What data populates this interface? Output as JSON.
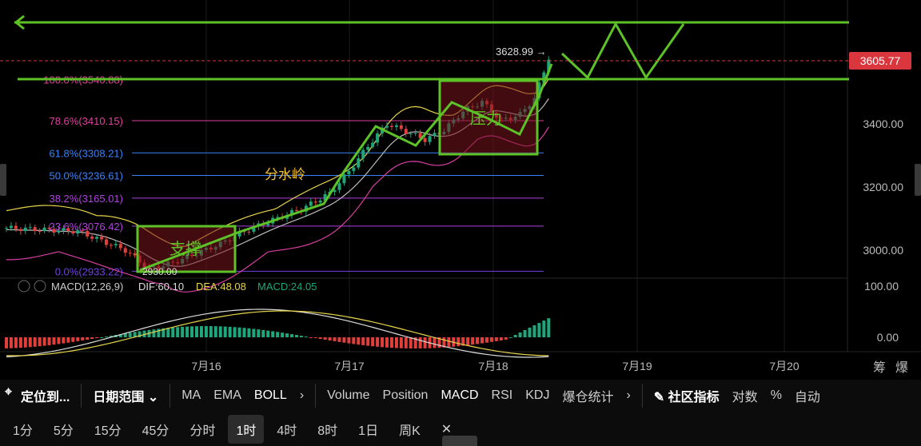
{
  "chart_data": {
    "type": "candlestick",
    "price_axis": {
      "ticks": [
        "3400.00",
        "3200.00",
        "3000.00"
      ],
      "current_price": "3605.77",
      "max_label": "3628.99",
      "min_label": "2930.00"
    },
    "macd_axis": {
      "ticks": [
        "100.00",
        "0.00"
      ]
    },
    "x_axis": {
      "ticks": [
        "7月16",
        "7月17",
        "7月18",
        "7月19",
        "7月20"
      ]
    },
    "fib_levels": [
      {
        "label": "100.0%(3540.88)",
        "price": 3540.88,
        "color": "#e040a0"
      },
      {
        "label": "78.6%(3410.15)",
        "price": 3410.15,
        "color": "#e040a0"
      },
      {
        "label": "61.8%(3308.21)",
        "price": 3308.21,
        "color": "#3b82f6"
      },
      {
        "label": "50.0%(3236.61)",
        "price": 3236.61,
        "color": "#3b82f6"
      },
      {
        "label": "38.2%(3165.01)",
        "price": 3165.01,
        "color": "#b040e0"
      },
      {
        "label": "23.6%(3076.42)",
        "price": 3076.42,
        "color": "#b040e0"
      },
      {
        "label": "0.0%(2933.22)",
        "price": 2933.22,
        "color": "#7040e0"
      }
    ],
    "annotations": {
      "support": "支撑",
      "resistance": "压力",
      "watershed": "分水岭"
    },
    "macd": {
      "title": "MACD(12,26,9)",
      "dif": "DIF:60.10",
      "dea": "DEA:48.08",
      "macd": "MACD:24.05"
    },
    "right_icons": [
      "筹",
      "爆"
    ]
  },
  "toolbar": {
    "locate": "定位到...",
    "date_range": "日期范围",
    "indicators": [
      "MA",
      "EMA",
      "BOLL"
    ],
    "sub_indicators": [
      "Volume",
      "Position",
      "MACD",
      "RSI",
      "KDJ",
      "爆仓统计"
    ],
    "community": "社区指标",
    "log": "对数",
    "pct": "%",
    "auto": "自动"
  },
  "intervals": [
    "1分",
    "5分",
    "15分",
    "45分",
    "分时",
    "1时",
    "4时",
    "8时",
    "1日",
    "周K"
  ],
  "colors": {
    "up": "#1fa67a",
    "down": "#e0403c",
    "bg": "#000000",
    "annotation_green": "#5cc227",
    "price_tag": "#d9363e"
  }
}
